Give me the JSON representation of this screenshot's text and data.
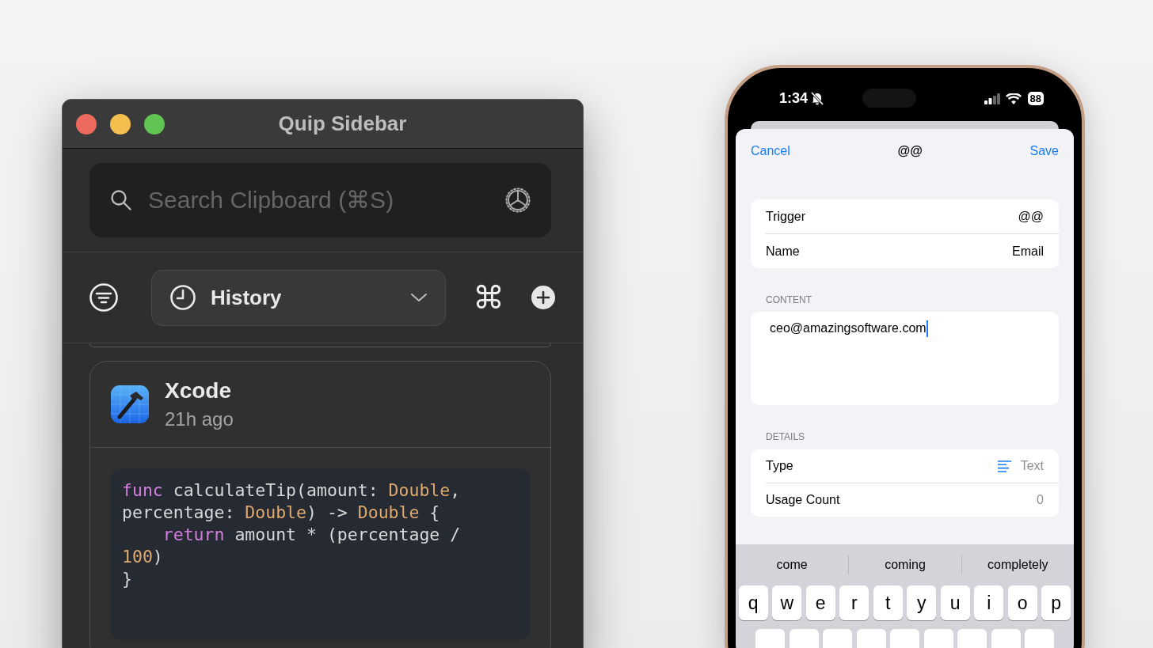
{
  "mac_window": {
    "title": "Quip Sidebar",
    "traffic_lights": [
      {
        "color": "#ec6a5e"
      },
      {
        "color": "#f4bf4f"
      },
      {
        "color": "#61c554"
      }
    ],
    "search": {
      "placeholder": "Search Clipboard (⌘S)"
    },
    "toolbar": {
      "dropdown": {
        "label": "History"
      },
      "command_symbol": "⌘"
    },
    "clip": {
      "app": "Xcode",
      "time": "21h ago",
      "code": [
        {
          "indented": false,
          "tokens": [
            {
              "kind": "keyword",
              "text": "func"
            },
            {
              "kind": "plain",
              "text": " calculateTip(amount: "
            },
            {
              "kind": "type",
              "text": "Double"
            },
            {
              "kind": "plain",
              "text": ","
            }
          ]
        },
        {
          "indented": false,
          "tokens": [
            {
              "kind": "plain",
              "text": "percentage: "
            },
            {
              "kind": "type",
              "text": "Double"
            },
            {
              "kind": "plain",
              "text": ") -> "
            },
            {
              "kind": "type",
              "text": "Double"
            },
            {
              "kind": "plain",
              "text": " {"
            }
          ]
        },
        {
          "indented": true,
          "tokens": [
            {
              "kind": "keyword",
              "text": "return"
            },
            {
              "kind": "plain",
              "text": " amount * (percentage /"
            }
          ]
        },
        {
          "indented": false,
          "tokens": [
            {
              "kind": "number",
              "text": "100"
            },
            {
              "kind": "plain",
              "text": ")"
            }
          ]
        },
        {
          "indented": false,
          "tokens": [
            {
              "kind": "plain",
              "text": "}"
            }
          ]
        }
      ]
    }
  },
  "phone": {
    "status_bar": {
      "time": "1:34",
      "battery": "88"
    },
    "nav": {
      "cancel": "Cancel",
      "title": "@@",
      "save": "Save"
    },
    "fields": [
      {
        "label": "Trigger",
        "value": "@@"
      },
      {
        "label": "Name",
        "value": "Email"
      }
    ],
    "content_label": "CONTENT",
    "content": {
      "value": "ceo@amazingsoftware.com"
    },
    "details_label": "DETAILS",
    "details": [
      {
        "kind": "type",
        "label": "Type",
        "value": "Text"
      },
      {
        "kind": "count",
        "label": "Usage Count",
        "value": "0"
      }
    ],
    "suggestions": [
      "come",
      "coming",
      "completely"
    ],
    "key_rows": [
      [
        "q",
        "w",
        "e",
        "r",
        "t",
        "y",
        "u",
        "i",
        "o",
        "p"
      ]
    ]
  }
}
